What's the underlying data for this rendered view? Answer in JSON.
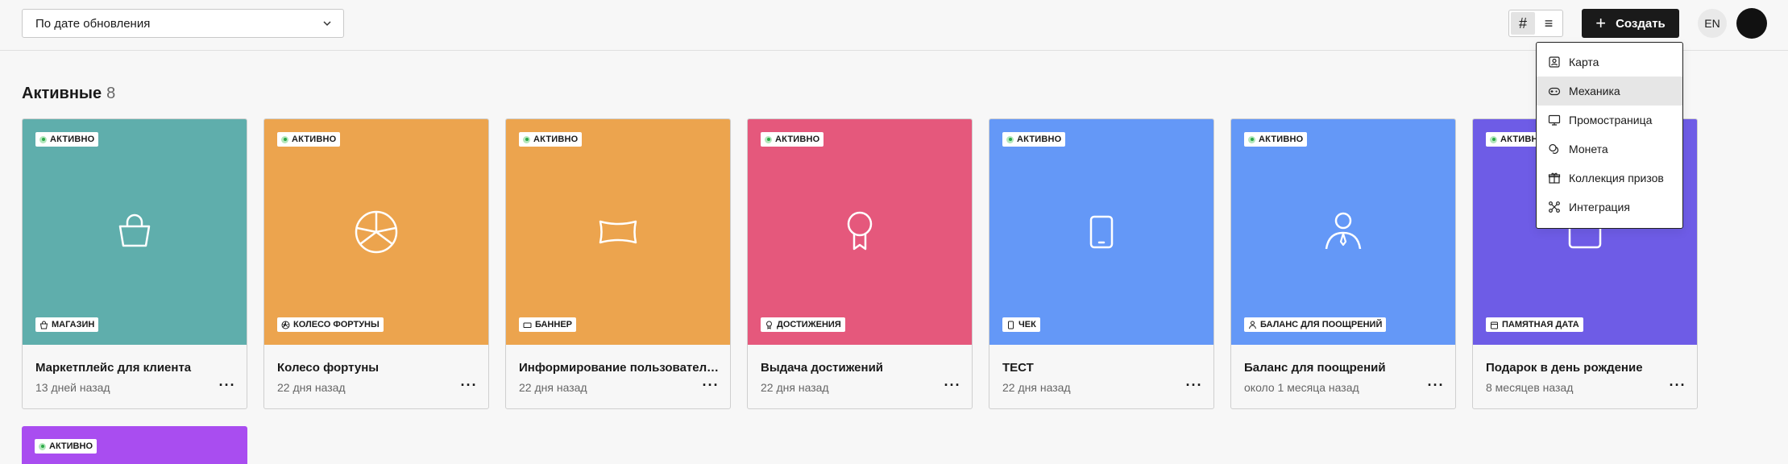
{
  "toolbar": {
    "sort_value": "По дате обновления",
    "view_grid_glyph": "#",
    "view_list_glyph": "≡",
    "create_label": "Создать",
    "lang": "EN"
  },
  "create_menu": {
    "items": [
      {
        "label": "Карта",
        "icon": "card-icon"
      },
      {
        "label": "Механика",
        "icon": "gamepad-icon"
      },
      {
        "label": "Промостраница",
        "icon": "monitor-icon"
      },
      {
        "label": "Монета",
        "icon": "coins-icon"
      },
      {
        "label": "Коллекция призов",
        "icon": "gift-icon"
      },
      {
        "label": "Интеграция",
        "icon": "integration-icon"
      }
    ]
  },
  "section": {
    "title": "Активные",
    "count": "8"
  },
  "cards": [
    {
      "status": "АКТИВНО",
      "type": "МАГАЗИН",
      "title": "Маркетплейс для клиента",
      "date": "13 дней назад",
      "color": "#5faeac",
      "icon": "shopping-bag-icon",
      "more": "···"
    },
    {
      "status": "АКТИВНО",
      "type": "КОЛЕСО ФОРТУНЫ",
      "title": "Колесо фортуны",
      "date": "22 дня назад",
      "color": "#eca44e",
      "icon": "wheel-icon",
      "more": "···"
    },
    {
      "status": "АКТИВНО",
      "type": "БАННЕР",
      "title": "Информирование пользователе...",
      "date": "22 дня назад",
      "color": "#eca44e",
      "icon": "banner-icon",
      "more": "···"
    },
    {
      "status": "АКТИВНО",
      "type": "ДОСТИЖЕНИЯ",
      "title": "Выдача достижений",
      "date": "22 дня назад",
      "color": "#e5587c",
      "icon": "award-icon",
      "more": "···"
    },
    {
      "status": "АКТИВНО",
      "type": "ЧЕК",
      "title": "ТЕСТ",
      "date": "22 дня назад",
      "color": "#6498f7",
      "icon": "tablet-icon",
      "more": "···"
    },
    {
      "status": "АКТИВНО",
      "type": "БАЛАНС ДЛЯ ПООЩРЕНИЙ",
      "title": "Баланс для поощрений",
      "date": "около 1 месяца назад",
      "color": "#6498f7",
      "icon": "person-icon",
      "more": "···"
    },
    {
      "status": "АКТИВНО",
      "type": "ПАМЯТНАЯ ДАТА",
      "title": "Подарок в день рождение",
      "date": "8 месяцев назад",
      "color": "#6e5ce6",
      "icon": "calendar-icon",
      "more": "···"
    }
  ],
  "partial_card": {
    "status": "АКТИВНО",
    "color": "#a94df0"
  }
}
